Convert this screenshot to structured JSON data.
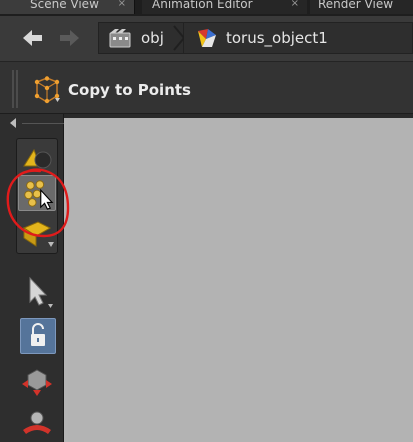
{
  "tabs": [
    {
      "label": "Scene View",
      "close": "×"
    },
    {
      "label": "Animation Editor",
      "close": "×"
    },
    {
      "label": "Render View",
      "close": "×"
    }
  ],
  "path": {
    "crumbs": [
      {
        "label": "obj",
        "icon": "obj-context-icon"
      },
      {
        "label": "torus_object1",
        "icon": "geometry-object-icon"
      }
    ]
  },
  "tool": {
    "title": "Copy to Points",
    "icon": "copy-to-points-icon"
  },
  "shelf": {
    "buttons": [
      {
        "name": "object-select-icon"
      },
      {
        "name": "point-select-icon",
        "active": true
      },
      {
        "name": "primitive-select-icon"
      },
      {
        "name": "select-arrow-icon"
      },
      {
        "name": "lock-icon",
        "active": true
      },
      {
        "name": "transform-handle-icon"
      },
      {
        "name": "rotate-handle-icon"
      }
    ]
  },
  "annotation": {
    "shape": "hand-drawn circle",
    "color": "#e01b1b"
  },
  "colors": {
    "viewport_bg": "#b4b4b4",
    "panel_bg": "#2e2e2e",
    "accent_lock": "#55749a",
    "highlight_red": "#e01b1b"
  }
}
